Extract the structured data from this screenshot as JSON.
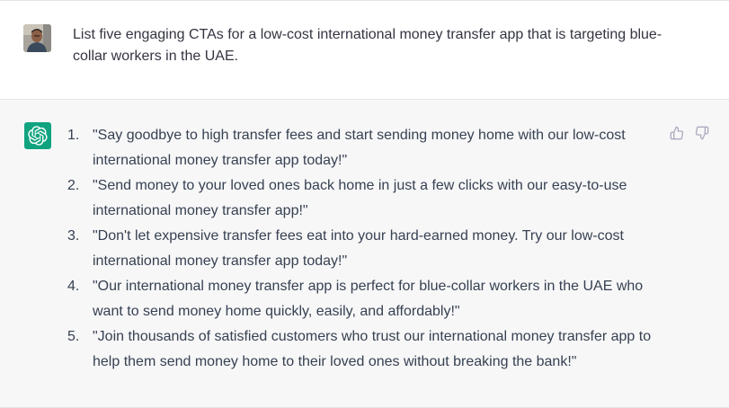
{
  "conversation": {
    "user_message": {
      "avatar": "user-photo-avatar",
      "text": "List five engaging CTAs for a low-cost international money transfer app that is targeting blue-collar workers in the UAE."
    },
    "assistant_message": {
      "avatar": "openai-logo-icon",
      "items": [
        {
          "number": "1.",
          "text": "\"Say goodbye to high transfer fees and start sending money home with our low-cost international money transfer app today!\""
        },
        {
          "number": "2.",
          "text": "\"Send money to your loved ones back home in just a few clicks with our easy-to-use international money transfer app!\""
        },
        {
          "number": "3.",
          "text": "\"Don't let expensive transfer fees eat into your hard-earned money. Try our low-cost international money transfer app today!\""
        },
        {
          "number": "4.",
          "text": "\"Our international money transfer app is perfect for blue-collar workers in the UAE who want to send money home quickly, easily, and affordably!\""
        },
        {
          "number": "5.",
          "text": "\"Join thousands of satisfied customers who trust our international money transfer app to help them send money home to their loved ones without breaking the bank!\""
        }
      ],
      "feedback": {
        "thumbs_up_icon": "thumbs-up-icon",
        "thumbs_down_icon": "thumbs-down-icon"
      }
    }
  },
  "colors": {
    "assistant_bg": "#f7f7f8",
    "brand_green": "#10a37f",
    "text": "#374151"
  }
}
